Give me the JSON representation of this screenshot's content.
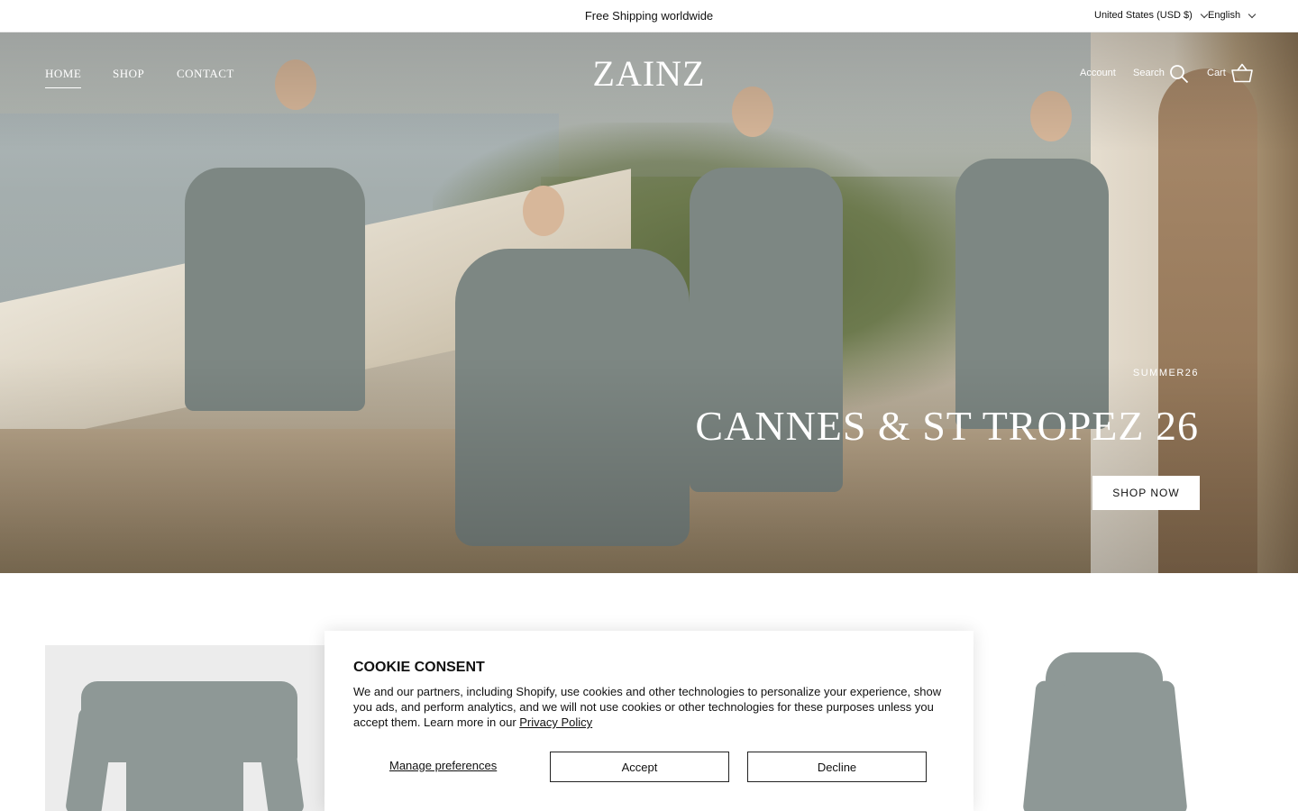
{
  "announcement": {
    "text": "Free Shipping worldwide",
    "country": "United States (USD $)",
    "language": "English"
  },
  "header": {
    "logo": "ZAINZ",
    "nav": [
      "HOME",
      "SHOP",
      "CONTACT"
    ],
    "account": "Account",
    "search": "Search",
    "cart": "Cart"
  },
  "hero": {
    "eyebrow": "SUMMER26",
    "title": "CANNES & ST TROPEZ 26",
    "button": "SHOP NOW"
  },
  "cookie": {
    "title": "COOKIE CONSENT",
    "body": "We and our partners, including Shopify, use cookies and other technologies to personalize your experience, show you ads, and perform analytics, and we will not use cookies or other technologies for these purposes unless you accept them. Learn more in our ",
    "policy_link": "Privacy Policy",
    "manage": "Manage preferences",
    "accept": "Accept",
    "decline": "Decline"
  },
  "colors": {
    "hero_text": "#ffffff",
    "garment": "#8e9896"
  }
}
